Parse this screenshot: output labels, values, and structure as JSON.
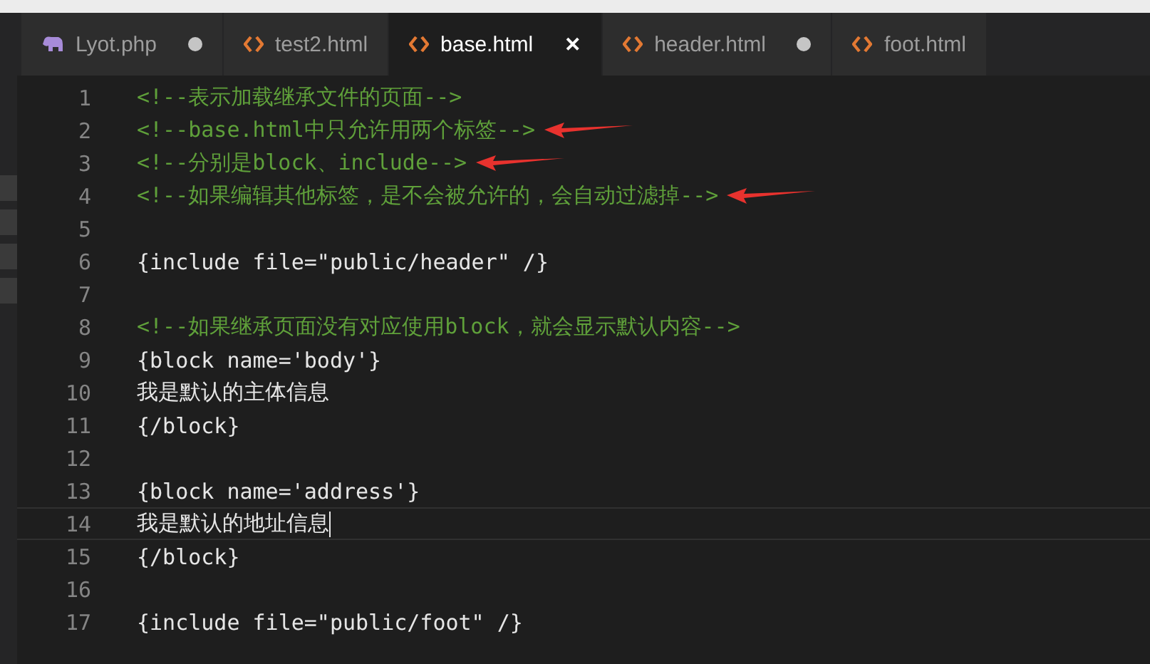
{
  "tabs": [
    {
      "label": "Lyot.php",
      "kind": "php",
      "dirty": true,
      "selected": false
    },
    {
      "label": "test2.html",
      "kind": "html",
      "dirty": false,
      "selected": false
    },
    {
      "label": "base.html",
      "kind": "html",
      "dirty": false,
      "selected": true
    },
    {
      "label": "header.html",
      "kind": "html",
      "dirty": true,
      "selected": false
    },
    {
      "label": "foot.html",
      "kind": "html",
      "dirty": false,
      "selected": false
    }
  ],
  "close_glyph": "✕",
  "lines": [
    {
      "number": "1",
      "text": "<!--表示加载继承文件的页面-->",
      "kind": "comment",
      "arrow": false,
      "current": false
    },
    {
      "number": "2",
      "text": "<!--base.html中只允许用两个标签-->",
      "kind": "comment",
      "arrow": true,
      "current": false
    },
    {
      "number": "3",
      "text": "<!--分别是block、include-->",
      "kind": "comment",
      "arrow": true,
      "current": false
    },
    {
      "number": "4",
      "text": "<!--如果编辑其他标签，是不会被允许的，会自动过滤掉-->",
      "kind": "comment",
      "arrow": true,
      "current": false
    },
    {
      "number": "5",
      "arrow": false,
      "current": false
    },
    {
      "number": "6",
      "text": "{include file=\"public/header\" /}",
      "kind": "code",
      "arrow": false,
      "current": false
    },
    {
      "number": "7",
      "arrow": false,
      "current": false
    },
    {
      "number": "8",
      "text": "<!--如果继承页面没有对应使用block，就会显示默认内容-->",
      "kind": "comment",
      "arrow": false,
      "current": false
    },
    {
      "number": "9",
      "text": "{block name='body'}",
      "kind": "code",
      "arrow": false,
      "current": false
    },
    {
      "number": "10",
      "text": "我是默认的主体信息",
      "kind": "code",
      "arrow": false,
      "current": false
    },
    {
      "number": "11",
      "text": "{/block}",
      "kind": "code",
      "arrow": false,
      "current": false
    },
    {
      "number": "12",
      "arrow": false,
      "current": false
    },
    {
      "number": "13",
      "text": "{block name='address'}",
      "kind": "code",
      "arrow": false,
      "current": false
    },
    {
      "number": "14",
      "text": "我是默认的地址信息",
      "kind": "code",
      "arrow": false,
      "current": true
    },
    {
      "number": "15",
      "text": "{/block}",
      "kind": "code",
      "arrow": false,
      "current": false
    },
    {
      "number": "16",
      "arrow": false,
      "current": false
    },
    {
      "number": "17",
      "text": "{include file=\"public/foot\" /}",
      "kind": "code",
      "arrow": false,
      "current": false
    }
  ]
}
